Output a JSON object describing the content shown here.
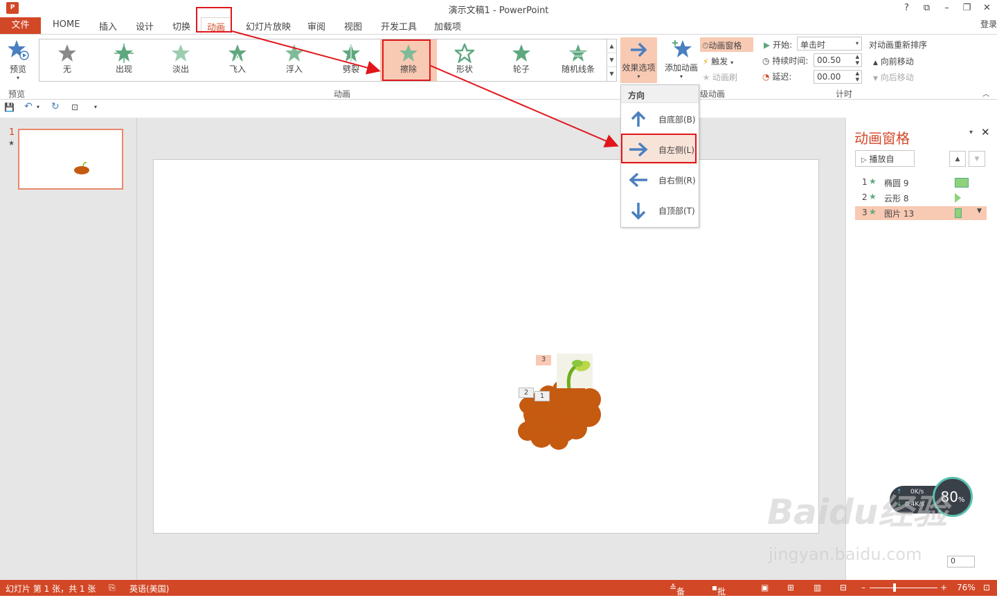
{
  "window": {
    "title": "演示文稿1 - PowerPoint",
    "controls": [
      "?",
      "⧉",
      "–",
      "❐",
      "✕"
    ],
    "login": "登录"
  },
  "tabs": {
    "file": "文件",
    "home": "HOME",
    "insert": "插入",
    "design": "设计",
    "transition": "切换",
    "animation": "动画",
    "slideshow": "幻灯片放映",
    "review": "审阅",
    "view": "视图",
    "developer": "开发工具",
    "addins": "加载项"
  },
  "ribbon": {
    "preview": {
      "label": "预览",
      "group": "预览"
    },
    "gallery": [
      {
        "label": "无"
      },
      {
        "label": "出现"
      },
      {
        "label": "淡出"
      },
      {
        "label": "飞入"
      },
      {
        "label": "浮入"
      },
      {
        "label": "劈裂"
      },
      {
        "label": "擦除",
        "selected": true
      },
      {
        "label": "形状"
      },
      {
        "label": "轮子"
      },
      {
        "label": "随机线条"
      }
    ],
    "animation_group": "动画",
    "effect_options": "效果选项",
    "add_animation": "添加动画",
    "anim_pane_btn": "动画窗格",
    "trigger": "触发",
    "anim_painter": "动画刷",
    "advanced_group": "级动画",
    "start_label": "开始:",
    "start_value": "单击时",
    "duration_label": "持续时间:",
    "duration_value": "00.50",
    "delay_label": "延迟:",
    "delay_value": "00.00",
    "reorder_title": "对动画重新排序",
    "move_earlier": "向前移动",
    "move_later": "向后移动",
    "timing_group": "计时"
  },
  "dropdown": {
    "header": "方向",
    "items": [
      {
        "label": "自底部(B)"
      },
      {
        "label": "自左侧(L)",
        "selected": true
      },
      {
        "label": "自右侧(R)"
      },
      {
        "label": "自顶部(T)"
      }
    ]
  },
  "thumbs": {
    "number": "1",
    "star": "★"
  },
  "slide": {
    "tags": [
      "3",
      "2",
      "1"
    ]
  },
  "anim_pane": {
    "title": "动画窗格",
    "play_from": "播放自",
    "items": [
      {
        "num": "1",
        "name": "椭圆 9"
      },
      {
        "num": "2",
        "name": "云形 8"
      },
      {
        "num": "3",
        "name": "图片 13",
        "selected": true
      }
    ]
  },
  "net": {
    "up": "0K/s",
    "down": "0.4K/s",
    "percent": "80",
    "unit": "%"
  },
  "watermark": {
    "brand": "Baidu经验",
    "url": "jingyan.baidu.com"
  },
  "status": {
    "slide_info": "幻灯片 第 1 张，共 1 张",
    "language": "英语(美国)",
    "notes": "备注",
    "comments": "批注",
    "zoom": "76%",
    "page_box": "0"
  },
  "colors": {
    "accent": "#d24726",
    "highlight": "#f8c9b3",
    "arrow_red": "#e0161b",
    "star_green": "#5fa87f",
    "blue": "#4a7fbf"
  }
}
